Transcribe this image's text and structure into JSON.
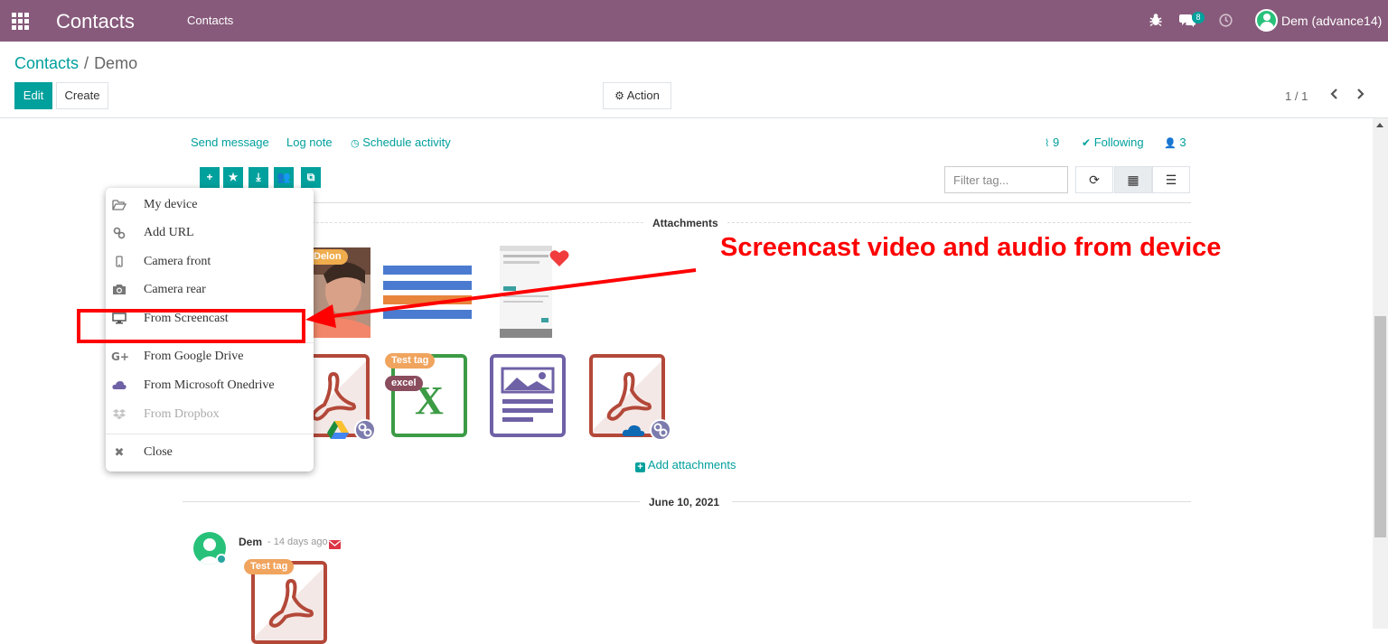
{
  "topbar": {
    "app_name": "Contacts",
    "menu_contacts": "Contacts",
    "message_count": "8",
    "user_name": "Dem (advance14)"
  },
  "breadcrumb": {
    "parent": "Contacts",
    "current": "Demo"
  },
  "control_panel": {
    "edit_label": "Edit",
    "create_label": "Create",
    "action_label": "Action",
    "pager": "1 / 1"
  },
  "chatter": {
    "send_message": "Send message",
    "log_note": "Log note",
    "schedule_activity": "Schedule activity",
    "attachment_count": "9",
    "following": "Following",
    "follower_count": "3",
    "filter_placeholder": "Filter tag...",
    "attachments_title": "Attachments",
    "add_attachments": "Add attachments",
    "date_separator": "June 10, 2021",
    "message_author": "Dem",
    "message_time": "- 14 days ago"
  },
  "attachments": {
    "photo_tag": "Delon",
    "excel_tag1": "Test tag",
    "excel_tag2": "excel",
    "message_tag": "Test tag"
  },
  "upload_menu": {
    "items": [
      {
        "label": "My device",
        "icon": "folder-open-icon"
      },
      {
        "label": "Add URL",
        "icon": "link-icon"
      },
      {
        "label": "Camera front",
        "icon": "mobile-icon"
      },
      {
        "label": "Camera rear",
        "icon": "camera-icon"
      },
      {
        "label": "From Screencast",
        "icon": "desktop-icon"
      },
      {
        "label": "From Google Drive",
        "icon": "google-plus-icon"
      },
      {
        "label": "From Microsoft Onedrive",
        "icon": "cloud-icon"
      },
      {
        "label": "From Dropbox",
        "icon": "dropbox-icon"
      },
      {
        "label": "Close",
        "icon": "close-icon"
      }
    ]
  },
  "annotation": {
    "text": "Screencast video and audio from device"
  },
  "colors": {
    "brand": "#875a7b",
    "accent": "#00a09d",
    "highlight": "#ff0000"
  }
}
